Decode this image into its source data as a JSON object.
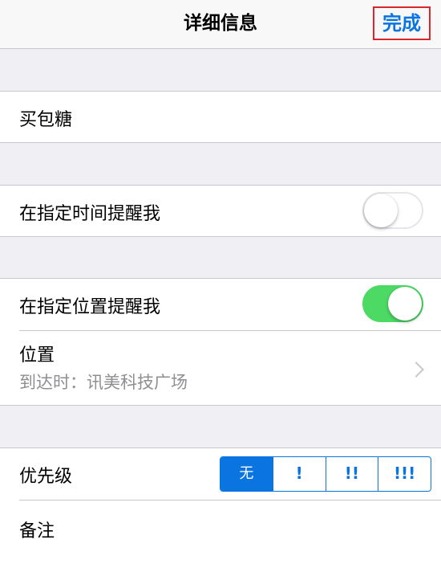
{
  "nav": {
    "title": "详细信息",
    "done_label": "完成"
  },
  "title_field": {
    "value": "买包糖"
  },
  "time_reminder": {
    "label": "在指定时间提醒我",
    "enabled": false
  },
  "location_reminder": {
    "label": "在指定位置提醒我",
    "enabled": true,
    "location_label": "位置",
    "location_detail": "到达时：讯美科技广场"
  },
  "priority": {
    "label": "优先级",
    "options": [
      "无",
      "!",
      "!!",
      "!!!"
    ],
    "selected": "无"
  },
  "notes": {
    "label": "备注"
  },
  "colors": {
    "accent": "#0a74e0",
    "toggle_on": "#4cd964",
    "highlight_border": "#d9272e"
  }
}
